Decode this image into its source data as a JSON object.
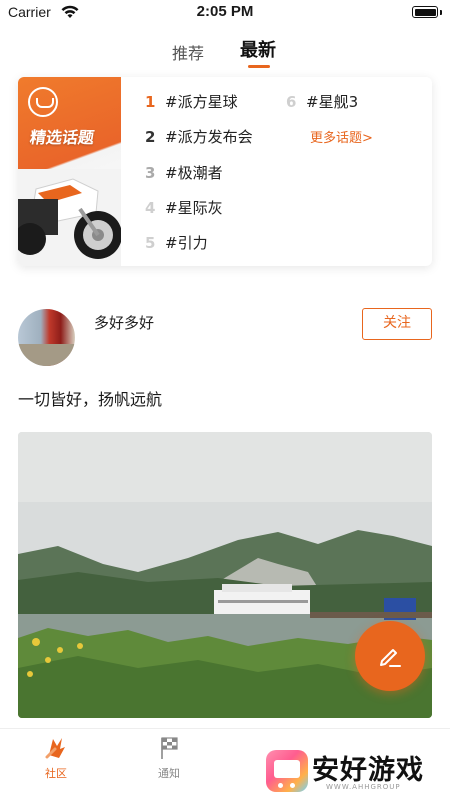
{
  "status_bar": {
    "carrier": "Carrier",
    "time": "2:05 PM"
  },
  "tabs": [
    {
      "label": "推荐",
      "active": false
    },
    {
      "label": "最新",
      "active": true
    }
  ],
  "hot_topics": {
    "banner_title": "精选话题",
    "items": [
      {
        "rank": "1",
        "tag": "#派方星球"
      },
      {
        "rank": "2",
        "tag": "#派方发布会"
      },
      {
        "rank": "3",
        "tag": "#极潮者"
      },
      {
        "rank": "4",
        "tag": "#星际灰"
      },
      {
        "rank": "5",
        "tag": "#引力"
      },
      {
        "rank": "6",
        "tag": "#星舰3"
      }
    ],
    "more_label": "更多话题>"
  },
  "post": {
    "username": "多好多好",
    "follow_label": "关注",
    "text": "一切皆好，扬帆远航"
  },
  "bottom_nav": [
    {
      "label": "社区",
      "icon": "community-icon",
      "active": true
    },
    {
      "label": "通知",
      "icon": "checkered-flag-icon",
      "active": false
    }
  ],
  "watermark": {
    "name": "安好游戏",
    "url": "WWW.AHHGROUP"
  },
  "colors": {
    "accent": "#e8661e",
    "text": "#1a1a1a",
    "muted": "#888888"
  }
}
